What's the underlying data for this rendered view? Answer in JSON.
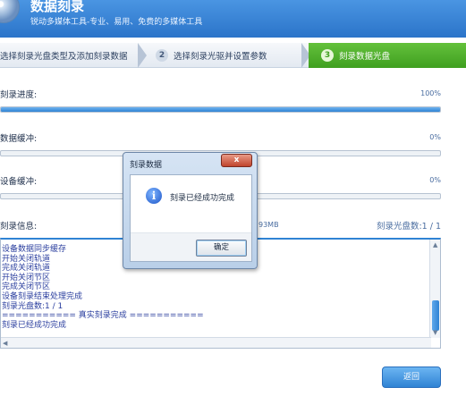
{
  "app": {
    "title": "数据刻录",
    "subtitle": "锐动多媒体工具-专业、易用、免费的多媒体工具"
  },
  "steps": [
    {
      "number": "1",
      "label": "选择刻录光盘类型及添加刻录数据"
    },
    {
      "number": "2",
      "label": "选择刻录光驱并设置参数"
    },
    {
      "number": "3",
      "label": "刻录数据光盘"
    }
  ],
  "progress": {
    "burn": {
      "label": "刻录进度:",
      "percent_text": "100%",
      "value": 1.0
    },
    "data_buffer": {
      "label": "数据缓冲:",
      "percent_text": "0%",
      "value": 0.0
    },
    "device_buffer": {
      "label": "设备缓冲:",
      "percent_text": "0%",
      "value": 0.0
    }
  },
  "info": {
    "label": "刻录信息:",
    "size_text": "93MB",
    "disc_count": "刻录光盘数:1 / 1"
  },
  "log_lines": [
    "设备数据同步缓存",
    "开始关闭轨道",
    "完成关闭轨道",
    "开始关闭节区",
    "完成关闭节区",
    "设备刻录结束处理完成",
    "刻录光盘数:1 / 1",
    "=========== 真实刻录完成 ===========",
    "刻录已经成功完成"
  ],
  "back_button": "返回",
  "dialog": {
    "title": "刻录数据",
    "close_symbol": "x",
    "icon": "info-icon",
    "message": "刻录已经成功完成",
    "ok_label": "确定"
  },
  "colors": {
    "header_blue": "#2b74c9",
    "active_step_green": "#4caf2d",
    "progress_blue": "#2f83d4"
  }
}
